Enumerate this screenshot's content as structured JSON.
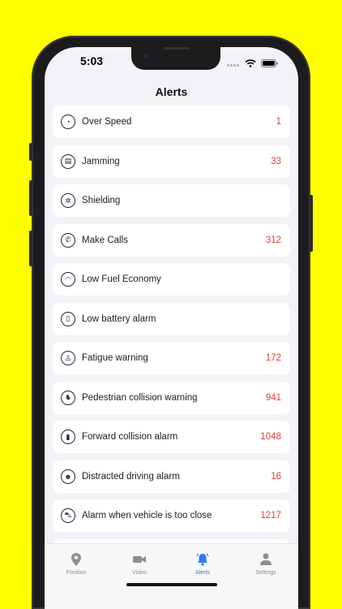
{
  "status": {
    "time": "5:03"
  },
  "nav": {
    "title": "Alerts"
  },
  "alerts": [
    {
      "label": "Over Speed",
      "count": "1",
      "icon": "speedometer-icon"
    },
    {
      "label": "Jamming",
      "count": "33",
      "icon": "jamming-icon"
    },
    {
      "label": "Shielding",
      "count": "",
      "icon": "shield-icon"
    },
    {
      "label": "Make Calls",
      "count": "312",
      "icon": "phone-icon"
    },
    {
      "label": "Low Fuel Economy",
      "count": "",
      "icon": "gauge-icon"
    },
    {
      "label": "Low battery alarm",
      "count": "",
      "icon": "battery-icon"
    },
    {
      "label": "Fatigue warning",
      "count": "172",
      "icon": "fatigue-icon"
    },
    {
      "label": "Pedestrian collision warning",
      "count": "941",
      "icon": "pedestrian-icon"
    },
    {
      "label": "Forward collision alarm",
      "count": "1048",
      "icon": "collision-icon"
    },
    {
      "label": "Distracted driving alarm",
      "count": "16",
      "icon": "distracted-icon"
    },
    {
      "label": "Alarm when vehicle is too close",
      "count": "1217",
      "icon": "car-icon"
    }
  ],
  "tabs": [
    {
      "label": "Position",
      "icon": "location-pin-icon",
      "active": false
    },
    {
      "label": "Video",
      "icon": "video-camera-icon",
      "active": false
    },
    {
      "label": "Alerts",
      "icon": "bell-icon",
      "active": true
    },
    {
      "label": "Settings",
      "icon": "person-icon",
      "active": false
    }
  ],
  "colors": {
    "accent": "#2f7bf5",
    "count": "#e53935",
    "background": "#FFFF00"
  }
}
